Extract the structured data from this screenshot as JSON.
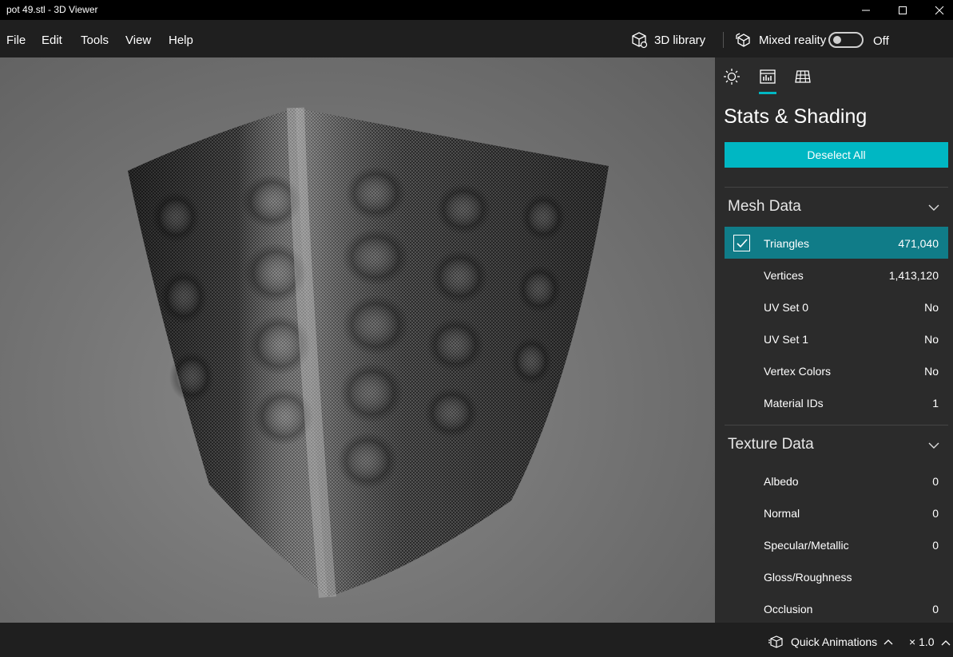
{
  "window": {
    "title": "pot 49.stl - 3D Viewer"
  },
  "menu": {
    "items": [
      "File",
      "Edit",
      "Tools",
      "View",
      "Help"
    ],
    "library_label": "3D library",
    "mixed_reality_label": "Mixed reality",
    "toggle_state": "Off"
  },
  "panel": {
    "tabs": [
      "sun-icon",
      "stats-icon",
      "grid-icon"
    ],
    "active_tab": 1,
    "title": "Stats & Shading",
    "deselect_label": "Deselect All",
    "mesh_section": "Mesh Data",
    "mesh_rows": [
      {
        "label": "Triangles",
        "value": "471,040",
        "selected": true
      },
      {
        "label": "Vertices",
        "value": "1,413,120"
      },
      {
        "label": "UV Set 0",
        "value": "No"
      },
      {
        "label": "UV Set 1",
        "value": "No"
      },
      {
        "label": "Vertex Colors",
        "value": "No"
      },
      {
        "label": "Material IDs",
        "value": "1"
      }
    ],
    "texture_section": "Texture Data",
    "texture_rows": [
      {
        "label": "Albedo",
        "value": "0"
      },
      {
        "label": "Normal",
        "value": "0"
      },
      {
        "label": "Specular/Metallic",
        "value": "0"
      },
      {
        "label": "Gloss/Roughness",
        "value": ""
      },
      {
        "label": "Occlusion",
        "value": "0"
      }
    ]
  },
  "status": {
    "quick_animations": "Quick Animations",
    "speed": "× 1.0"
  },
  "colors": {
    "accent": "#00b7c3",
    "selected_row": "#107c88",
    "panel_bg": "#2b2b2b",
    "app_bg": "#1f1f1f"
  }
}
